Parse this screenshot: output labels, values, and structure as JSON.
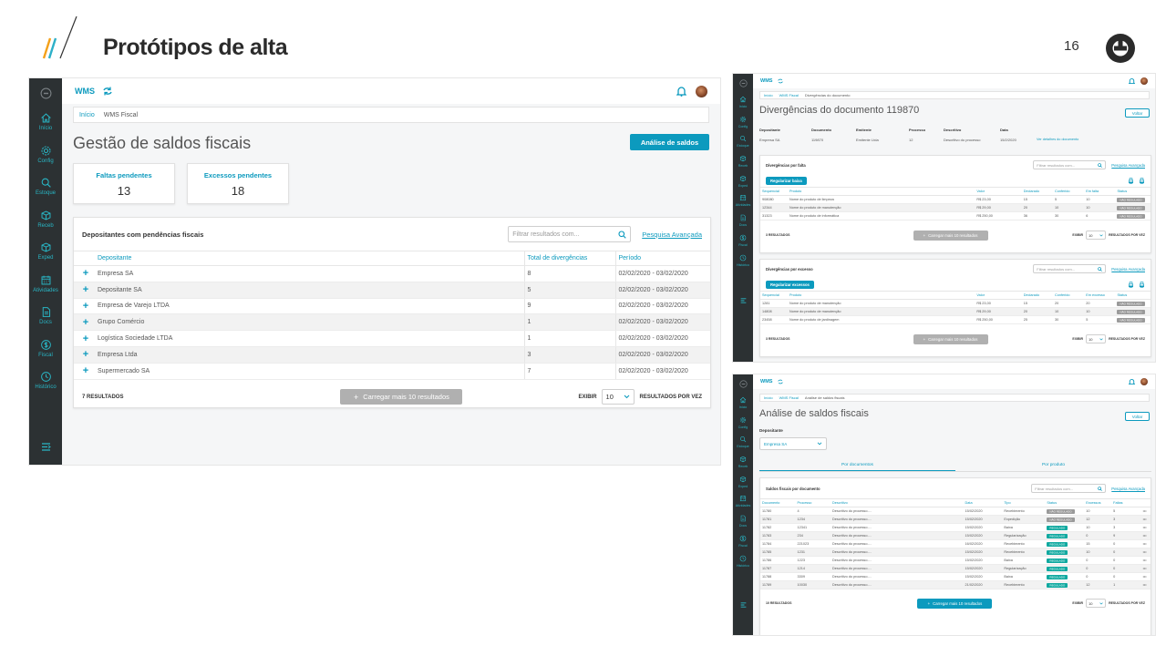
{
  "slide": {
    "title": "Protótipos de alta",
    "page": "16"
  },
  "main": {
    "app_name": "WMS",
    "sidebar": [
      {
        "label": "Início",
        "icon": "home-icon"
      },
      {
        "label": "Config",
        "icon": "gear-icon"
      },
      {
        "label": "Estoque",
        "icon": "search-icon"
      },
      {
        "label": "Receb",
        "icon": "box-icon"
      },
      {
        "label": "Exped",
        "icon": "box-icon"
      },
      {
        "label": "Atividades",
        "icon": "calendar-icon"
      },
      {
        "label": "Docs",
        "icon": "document-icon"
      },
      {
        "label": "Fiscal",
        "icon": "dollar-icon"
      },
      {
        "label": "Histórico",
        "icon": "clock-icon"
      }
    ],
    "breadcrumb": [
      "Início",
      "WMS Fiscal"
    ],
    "title": "Gestão de saldos fiscais",
    "action_button": "Análise de saldos",
    "kpis": [
      {
        "label": "Faltas pendentes",
        "value": "13"
      },
      {
        "label": "Excessos pendentes",
        "value": "18"
      }
    ],
    "card": {
      "title": "Depositantes com pendências fiscais",
      "search_placeholder": "Filtrar resultados com...",
      "advanced": "Pesquisa Avançada",
      "columns": [
        "Depositante",
        "Total de divergências",
        "Período"
      ],
      "rows": [
        {
          "name": "Empresa SA",
          "total": "8",
          "period": "02/02/2020 - 03/02/2020"
        },
        {
          "name": "Depositante SA",
          "total": "5",
          "period": "02/02/2020 - 03/02/2020"
        },
        {
          "name": "Empresa de Varejo LTDA",
          "total": "9",
          "period": "02/02/2020 - 03/02/2020"
        },
        {
          "name": "Grupo Comércio",
          "total": "1",
          "period": "02/02/2020 - 03/02/2020"
        },
        {
          "name": "Logística Sociedade LTDA",
          "total": "1",
          "period": "02/02/2020 - 03/02/2020"
        },
        {
          "name": "Empresa Ltda",
          "total": "3",
          "period": "02/02/2020 - 03/02/2020"
        },
        {
          "name": "Supermercado SA",
          "total": "7",
          "period": "02/02/2020 - 03/02/2020"
        }
      ],
      "result_count": "7 RESULTADOS",
      "load_more": "Carregar mais 10 resultados",
      "show_label": "EXIBIR",
      "page_size": "10",
      "per_page_label": "RESULTADOS POR VEZ"
    }
  },
  "top_right": {
    "app_name": "WMS",
    "breadcrumb": [
      "Início",
      "WMS Fiscal",
      "Divergências do documento"
    ],
    "title": "Divergências do documento 119870",
    "back_button": "Voltar",
    "info_headers": [
      "Depositante",
      "Documento",
      "Emitente",
      "Processo",
      "Descritivo",
      "Data"
    ],
    "info_values": [
      "Empresa SA",
      "119870",
      "Emitente Ltda",
      "12",
      "Descritivo do processo",
      "15/2/2020"
    ],
    "info_link": "Ver detalhes do documento",
    "shortage": {
      "title": "Divergências por falta",
      "search_placeholder": "Filtrar resultados com...",
      "advanced": "Pesquisa Avançada",
      "button": "Regularizar baixa",
      "columns": [
        "Sequencial",
        "Produto",
        "Valor",
        "Declarado",
        "Conferido",
        "Em falta",
        "Status"
      ],
      "rows": [
        [
          "908080",
          "Nome do produto de limpeza",
          "R$ 23,00",
          "15",
          "5",
          "10",
          "NÃO REGULADO"
        ],
        [
          "12344",
          "Nome do produto de manutenção",
          "R$ 29,00",
          "20",
          "10",
          "10",
          "NÃO REGULADO"
        ],
        [
          "31323",
          "Nome do produto de informática",
          "R$ 250,00",
          "36",
          "30",
          "6",
          "NÃO REGULADO"
        ]
      ],
      "result_count": "3 RESULTADOS",
      "load_more": "Carregar mais 10 resultados",
      "show_label": "EXIBIR",
      "page_size": "10",
      "per_page_label": "RESULTADOS POR VEZ"
    },
    "excess": {
      "title": "Divergências por excesso",
      "search_placeholder": "Filtrar resultados com...",
      "advanced": "Pesquisa Avançada",
      "button": "Regularizar excessos",
      "columns": [
        "Sequencial",
        "Produto",
        "Valor",
        "Declarado",
        "Conferido",
        "Em excesso",
        "Status"
      ],
      "rows": [
        [
          "1281",
          "Nome do produto de manutenção",
          "R$ 23,00",
          "15",
          "20",
          "20",
          "NÃO REGULADO"
        ],
        [
          "14808",
          "Nome do produto de manutenção",
          "R$ 29,00",
          "20",
          "10",
          "10",
          "NÃO REGULADO"
        ],
        [
          "23458",
          "Nome do produto de jardinagem",
          "R$ 250,00",
          "25",
          "30",
          "5",
          "NÃO REGULADO"
        ]
      ],
      "result_count": "3 RESULTADOS",
      "load_more": "Carregar mais 10 resultados",
      "show_label": "EXIBIR",
      "page_size": "10",
      "per_page_label": "RESULTADOS POR VEZ"
    }
  },
  "bottom_right": {
    "app_name": "WMS",
    "breadcrumb": [
      "Início",
      "WMS Fiscal",
      "Análise de saldos fiscais"
    ],
    "title": "Análise de saldos fiscais",
    "back_button": "Voltar",
    "depositor_label": "Depositante",
    "depositor_value": "Empresa SA",
    "tabs": [
      "Por documentos",
      "Por produto"
    ],
    "card_title": "Saldos fiscais por documento",
    "search_placeholder": "Filtrar resultados com...",
    "advanced": "Pesquisa Avançada",
    "columns": [
      "Documento",
      "Processo",
      "Descritivo",
      "Data",
      "Tipo",
      "Status",
      "Excessos",
      "Faltas"
    ],
    "rows": [
      [
        "11780",
        "4",
        "Descritivo do processo....",
        "15/02/2020",
        "Recebimento",
        "NÃO REGULADO",
        "10",
        "5"
      ],
      [
        "11781",
        "1234",
        "Descritivo do processo....",
        "15/02/2020",
        "Expedição",
        "NÃO REGULADO",
        "12",
        "3"
      ],
      [
        "11782",
        "12341",
        "Descritivo do processo....",
        "15/02/2020",
        "Baixa",
        "REGULADO",
        "10",
        "3"
      ],
      [
        "11783",
        "234",
        "Descritivo do processo....",
        "15/02/2020",
        "Regularização",
        "REGULADO",
        "0",
        "9"
      ],
      [
        "11784",
        "221023",
        "Descritivo do processo....",
        "16/02/2020",
        "Recebimento",
        "REGULADO",
        "15",
        "0"
      ],
      [
        "11785",
        "1231",
        "Descritivo do processo....",
        "15/02/2020",
        "Recebimento",
        "REGULADO",
        "10",
        "0"
      ],
      [
        "11786",
        "1223",
        "Descritivo do processo....",
        "15/02/2020",
        "Baixa",
        "REGULADO",
        "0",
        "0"
      ],
      [
        "11787",
        "1214",
        "Descritivo do processo....",
        "15/02/2020",
        "Regularização",
        "REGULADO",
        "0",
        "0"
      ],
      [
        "11788",
        "3309",
        "Descritivo do processo....",
        "15/02/2020",
        "Baixa",
        "REGULADO",
        "0",
        "0"
      ],
      [
        "11789",
        "10030",
        "Descritivo do processo....",
        "21/02/2020",
        "Recebimento",
        "REGULADO",
        "12",
        "1"
      ]
    ],
    "row_menu": "•••",
    "result_count": "10 RESULTADOS",
    "load_more": "Carregar mais 10 resultados",
    "show_label": "EXIBIR",
    "page_size": "10",
    "per_page_label": "RESULTADOS POR VEZ"
  }
}
